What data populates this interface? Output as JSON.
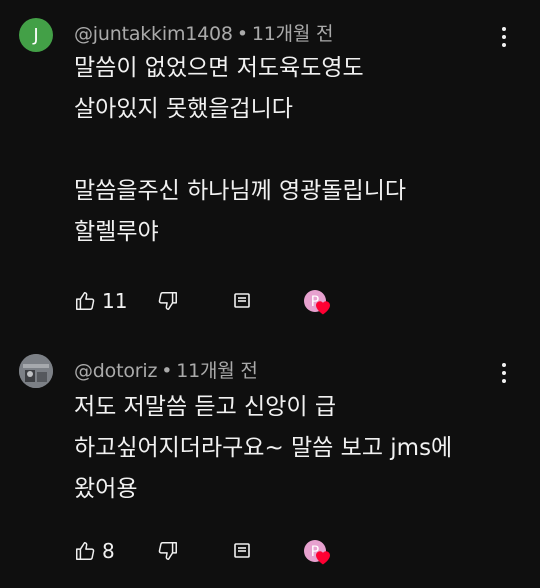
{
  "comments": [
    {
      "avatar_letter": "J",
      "author": "@juntakkim1408",
      "separator": "•",
      "time": "11개월 전",
      "lines": [
        "말씀이 없었으면 저도육도영도",
        "살아있지 못했을겁니다",
        "",
        "말씀을주신 하나님께 영광돌립니다",
        "할렐루야"
      ],
      "like_count": "11"
    },
    {
      "avatar_letter": "",
      "author": "@dotoriz",
      "separator": "•",
      "time": "11개월 전",
      "lines": [
        "저도 저말씀 듣고 신앙이 급",
        "하고싶어지더라구요~ 말씀 보고 jms에",
        "왔어용"
      ],
      "like_count": "8"
    }
  ],
  "colors": {
    "background": "#0f0f0f",
    "text_primary": "#f1f1f1",
    "text_secondary": "#aaaaaa",
    "avatar_j": "#43a047",
    "creator_badge": "#e7a1cf",
    "heart": "#ff0033"
  },
  "icons": {
    "like": "thumbs-up-icon",
    "dislike": "thumbs-down-icon",
    "reply": "reply-icon",
    "creator_heart": "creator-heart-icon",
    "more": "more-vert-icon"
  }
}
